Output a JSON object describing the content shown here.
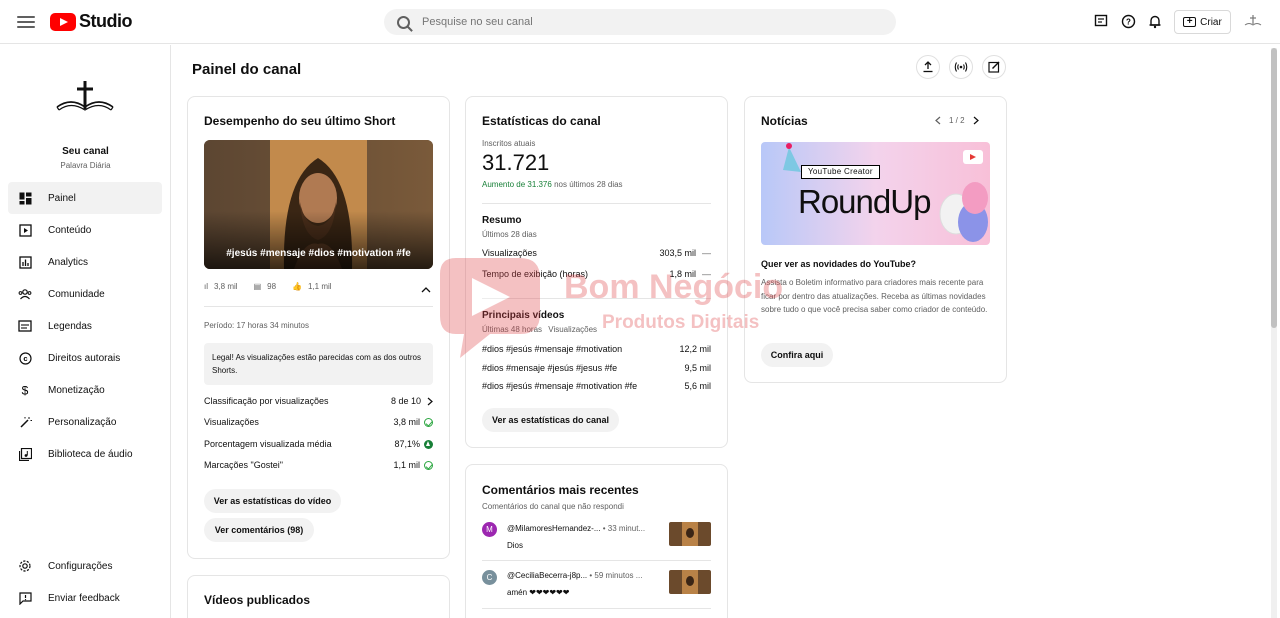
{
  "header": {
    "logo_text": "Studio",
    "search_placeholder": "Pesquise no seu canal",
    "create_label": "Criar"
  },
  "sidebar": {
    "channel_name": "Seu canal",
    "channel_subtitle": "Palavra Diária",
    "items": [
      {
        "label": "Painel",
        "icon": "dashboard-icon",
        "active": true
      },
      {
        "label": "Conteúdo",
        "icon": "content-icon"
      },
      {
        "label": "Analytics",
        "icon": "analytics-icon"
      },
      {
        "label": "Comunidade",
        "icon": "community-icon"
      },
      {
        "label": "Legendas",
        "icon": "subtitles-icon"
      },
      {
        "label": "Direitos autorais",
        "icon": "copyright-icon"
      },
      {
        "label": "Monetização",
        "icon": "dollar-icon"
      },
      {
        "label": "Personalização",
        "icon": "magic-wand-icon"
      },
      {
        "label": "Biblioteca de áudio",
        "icon": "audio-library-icon"
      }
    ],
    "bottom": [
      {
        "label": "Configurações",
        "icon": "gear-icon"
      },
      {
        "label": "Enviar feedback",
        "icon": "feedback-icon"
      }
    ]
  },
  "page": {
    "title": "Painel do canal"
  },
  "short_card": {
    "title": "Desempenho do seu último Short",
    "thumb_caption": "#jesús #mensaje #dios #motivation #fe",
    "stats": {
      "views": "3,8 mil",
      "comments": "98",
      "likes": "1,1 mil"
    },
    "period": "Período: 17 horas 34 minutos",
    "message": "Legal! As visualizações estão parecidas com as dos outros Shorts.",
    "rows": [
      {
        "label": "Classificação por visualizações",
        "value": "8 de 10"
      },
      {
        "label": "Visualizações",
        "value": "3,8 mil"
      },
      {
        "label": "Porcentagem visualizada média",
        "value": "87,1%"
      },
      {
        "label": "Marcações \"Gostei\"",
        "value": "1,1 mil"
      }
    ],
    "btn_stats": "Ver as estatísticas do vídeo",
    "btn_comments": "Ver comentários (98)"
  },
  "published_card": {
    "title": "Vídeos publicados"
  },
  "stats_card": {
    "title": "Estatísticas do canal",
    "subs_label": "Inscritos atuais",
    "subs_value": "31.721",
    "growth_highlight": "Aumento de 31.376",
    "growth_rest": "nos últimos 28 dias",
    "summary_title": "Resumo",
    "summary_sub": "Últimos 28 dias",
    "summary_rows": [
      {
        "label": "Visualizações",
        "value": "303,5 mil",
        "trend": "—"
      },
      {
        "label": "Tempo de exibição (horas)",
        "value": "1,8 mil",
        "trend": "—"
      }
    ],
    "top_title": "Principais vídeos",
    "top_sub_a": "Últimas 48 horas",
    "top_sub_b": "Visualizações",
    "top_rows": [
      {
        "label": "#dios #jesús #mensaje #motivation",
        "value": "12,2 mil"
      },
      {
        "label": "#dios #mensaje #jesús #jesus #fe",
        "value": "9,5 mil"
      },
      {
        "label": "#dios #jesús #mensaje #motivation #fe",
        "value": "5,6 mil"
      }
    ],
    "btn": "Ver as estatísticas do canal"
  },
  "comments_card": {
    "title": "Comentários mais recentes",
    "subtitle": "Comentários do canal que não respondi",
    "items": [
      {
        "initial": "M",
        "author": "@MilamoresHernandez-...",
        "time": "• 33 minut...",
        "text": "Dios",
        "color": "#9c27b0"
      },
      {
        "initial": "C",
        "author": "@CeciliaBecerra-j8p...",
        "time": "• 59 minutos ...",
        "text": "amén ❤❤❤❤❤❤",
        "color": "#78909c"
      }
    ]
  },
  "news_card": {
    "title": "Notícias",
    "pager": "1 / 2",
    "banner_tag": "YouTube Creator",
    "banner_title": "RoundUp",
    "headline": "Quer ver as novidades do YouTube?",
    "body": "Assista o Boletim informativo para criadores mais recente para ficar por dentro das atualizações. Receba as últimas novidades sobre tudo o que você precisa saber como criador de conteúdo.",
    "btn": "Confira aqui"
  },
  "watermark": {
    "title": "Bom Negócio",
    "subtitle": "Produtos Digitais"
  },
  "colors": {
    "brand_red": "#ff0000",
    "growth_green": "#188038",
    "check_green": "#2ba640"
  }
}
